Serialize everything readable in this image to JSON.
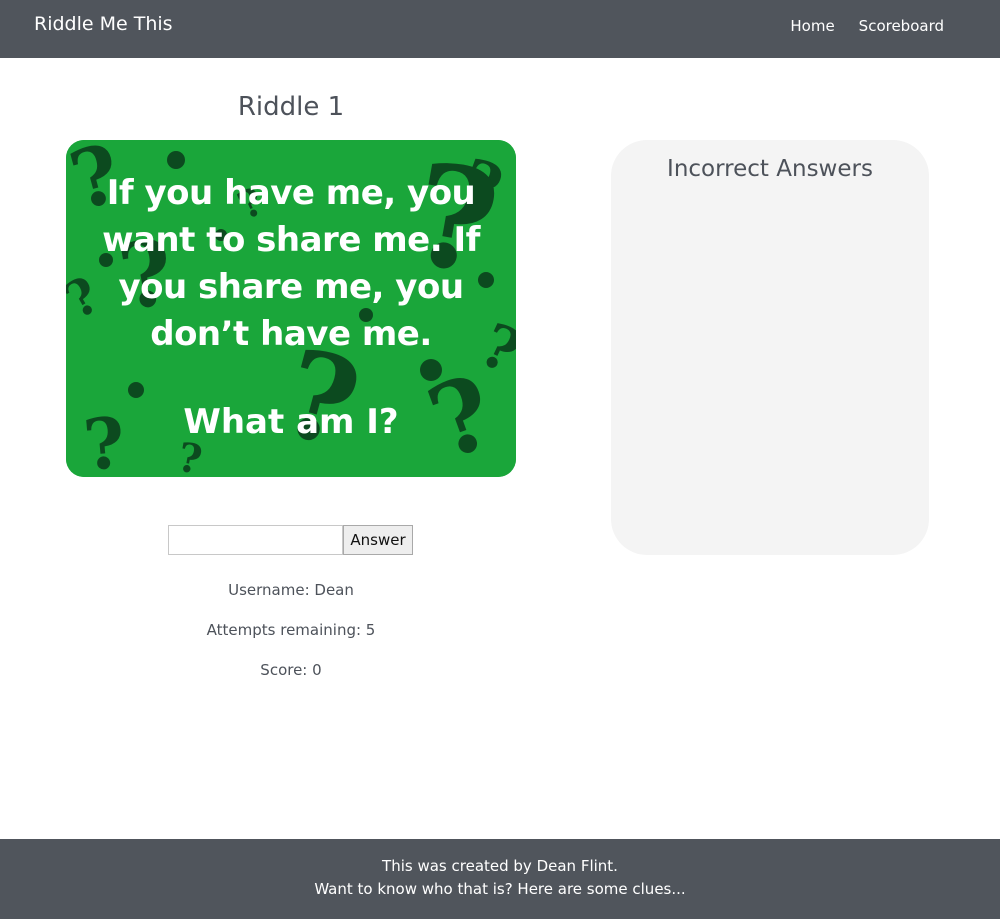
{
  "nav": {
    "brand": "Riddle Me This",
    "links": [
      {
        "label": "Home"
      },
      {
        "label": "Scoreboard"
      }
    ]
  },
  "riddle": {
    "title": "Riddle 1",
    "text": "If you have me, you want to share me. If you share me, you don’t have me.",
    "question": "What am I?"
  },
  "answer_form": {
    "input_value": "",
    "button_label": "Answer"
  },
  "stats": {
    "username": "Username: Dean",
    "attempts": "Attempts remaining: 5",
    "score": "Score: 0"
  },
  "incorrect_answers": {
    "title": "Incorrect Answers",
    "items": []
  },
  "footer": {
    "line1": "This was created by Dean Flint.",
    "line2": "Want to know who that is? Here are some clues..."
  },
  "colors": {
    "header_bg": "#50555c",
    "riddle_green": "#1aa63a",
    "panel_bg": "#f4f4f4"
  }
}
